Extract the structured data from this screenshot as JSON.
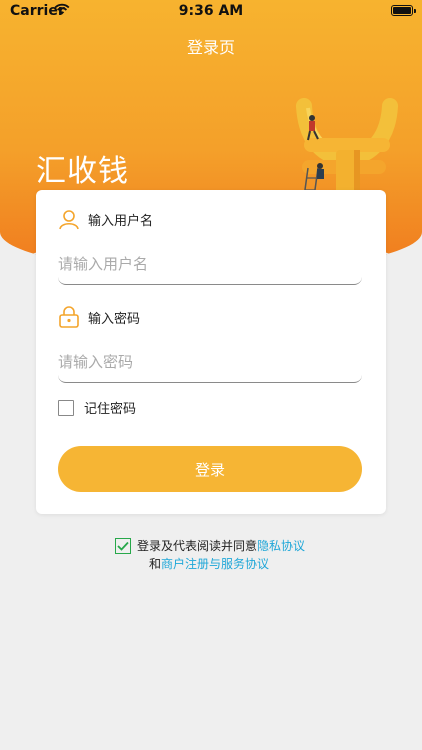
{
  "status_bar": {
    "carrier": "Carrier",
    "time": "9:36 AM"
  },
  "nav": {
    "title": "登录页"
  },
  "brand": {
    "app_name": "汇收钱"
  },
  "form": {
    "username": {
      "label": "输入用户名",
      "placeholder": "请输入用户名",
      "value": ""
    },
    "password": {
      "label": "输入密码",
      "placeholder": "请输入密码",
      "value": ""
    },
    "remember": {
      "label": "记住密码",
      "checked": false
    },
    "login_button": "登录"
  },
  "agreement": {
    "checked": true,
    "prefix": "登录及代表阅读并同意",
    "privacy_link": "隐私协议",
    "connector": "和",
    "terms_link": "商户注册与服务协议"
  },
  "colors": {
    "accent": "#f6b534",
    "link": "#1fa7d8",
    "check": "#27a84a"
  }
}
